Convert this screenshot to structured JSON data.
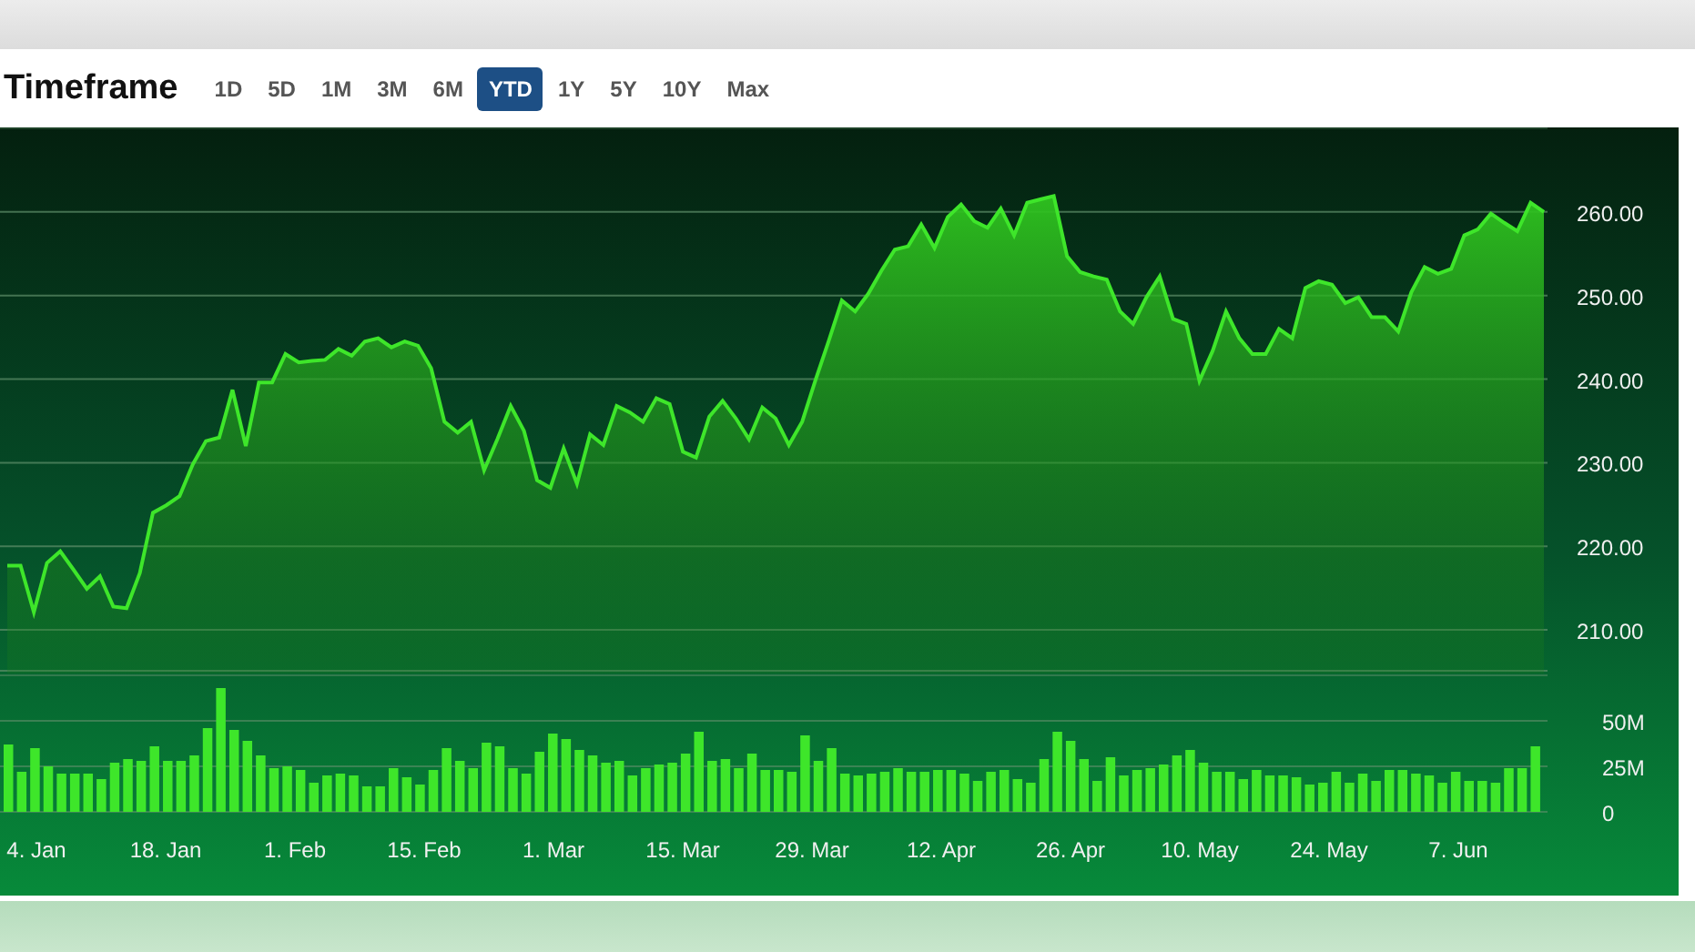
{
  "header": {
    "title": "Timeframe",
    "ranges": [
      {
        "label": "1D",
        "selected": false
      },
      {
        "label": "5D",
        "selected": false
      },
      {
        "label": "1M",
        "selected": false
      },
      {
        "label": "3M",
        "selected": false
      },
      {
        "label": "6M",
        "selected": false
      },
      {
        "label": "YTD",
        "selected": true
      },
      {
        "label": "1Y",
        "selected": false
      },
      {
        "label": "5Y",
        "selected": false
      },
      {
        "label": "10Y",
        "selected": false
      },
      {
        "label": "Max",
        "selected": false
      }
    ]
  },
  "price_chart": {
    "chart_data": {
      "type": "area",
      "grid": true,
      "ylim": [
        205,
        270
      ],
      "yticks": [
        {
          "value": 210,
          "label": "210.00"
        },
        {
          "value": 220,
          "label": "220.00"
        },
        {
          "value": 230,
          "label": "230.00"
        },
        {
          "value": 240,
          "label": "240.00"
        },
        {
          "value": 250,
          "label": "250.00"
        },
        {
          "value": 260,
          "label": "260.00"
        }
      ],
      "series": [
        {
          "color": "#3ee62a",
          "values": [
            217.7,
            217.7,
            212.1,
            218,
            219.4,
            217.2,
            214.9,
            216.4,
            212.8,
            212.6,
            216.8,
            224,
            224.9,
            226,
            229.8,
            232.6,
            233,
            238.7,
            232,
            239.6,
            239.6,
            243,
            242,
            242.2,
            242.3,
            243.6,
            242.8,
            244.5,
            244.9,
            243.8,
            244.5,
            244,
            241.3,
            234.9,
            233.6,
            234.9,
            229.1,
            232.8,
            236.8,
            233.8,
            227.9,
            227,
            231.7,
            227.5,
            233.4,
            232.1,
            236.8,
            236,
            234.9,
            237.7,
            237,
            231.3,
            230.6,
            235.5,
            237.4,
            235.3,
            232.8,
            236.6,
            235.3,
            232.1,
            234.9,
            239.8,
            244.5,
            249.4,
            248.1,
            250.2,
            253,
            255.5,
            255.9,
            258.5,
            255.7,
            259.4,
            260.9,
            258.9,
            258.1,
            260.4,
            257.2,
            261.1,
            261.5,
            261.9,
            254.7,
            252.8,
            252.3,
            251.9,
            248.1,
            246.6,
            249.8,
            252.3,
            247.2,
            246.6,
            239.8,
            243.4,
            248.1,
            244.9,
            243,
            243,
            246,
            244.9,
            250.9,
            251.7,
            251.3,
            249.1,
            249.8,
            247.4,
            247.4,
            245.7,
            250.4,
            253.4,
            252.6,
            253.2,
            257.2,
            257.9,
            259.8,
            258.7,
            257.7,
            261.1,
            260
          ]
        }
      ]
    }
  },
  "volume_chart": {
    "date_labels": [
      "4. Jan",
      "18. Jan",
      "1. Feb",
      "15. Feb",
      "1. Mar",
      "15. Mar",
      "29. Mar",
      "12. Apr",
      "26. Apr",
      "10. May",
      "24. May",
      "7. Jun"
    ],
    "chart_data": {
      "type": "bar",
      "grid": true,
      "ylim": [
        0,
        75
      ],
      "yticks": [
        {
          "value": 0,
          "label": "0"
        },
        {
          "value": 25,
          "label": "25M"
        },
        {
          "value": 50,
          "label": "50M"
        }
      ],
      "series": [
        {
          "color": "#3ee62a",
          "values": [
            37,
            22,
            35,
            25,
            21,
            21,
            21,
            18,
            27,
            29,
            28,
            36,
            28,
            28,
            31,
            46,
            68,
            45,
            39,
            31,
            24,
            25,
            23,
            16,
            20,
            21,
            20,
            14,
            14,
            24,
            19,
            15,
            23,
            35,
            28,
            24,
            38,
            36,
            24,
            21,
            33,
            43,
            40,
            34,
            31,
            27,
            28,
            20,
            24,
            26,
            27,
            32,
            44,
            28,
            29,
            24,
            32,
            23,
            23,
            22,
            42,
            28,
            35,
            21,
            20,
            21,
            22,
            24,
            22,
            22,
            23,
            23,
            21,
            17,
            22,
            23,
            18,
            16,
            29,
            44,
            39,
            29,
            17,
            30,
            20,
            23,
            24,
            26,
            31,
            34,
            27,
            22,
            22,
            18,
            23,
            20,
            20,
            19,
            15,
            16,
            22,
            16,
            21,
            17,
            23,
            23,
            21,
            20,
            16,
            22,
            17,
            17,
            16,
            24,
            24,
            36
          ]
        }
      ]
    }
  }
}
